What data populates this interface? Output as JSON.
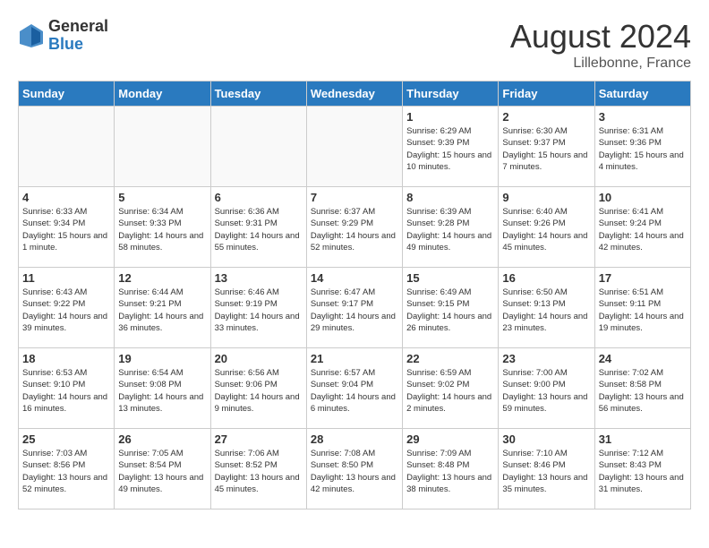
{
  "header": {
    "logo_general": "General",
    "logo_blue": "Blue",
    "month_year": "August 2024",
    "location": "Lillebonne, France"
  },
  "days_of_week": [
    "Sunday",
    "Monday",
    "Tuesday",
    "Wednesday",
    "Thursday",
    "Friday",
    "Saturday"
  ],
  "weeks": [
    [
      {
        "day": "",
        "info": ""
      },
      {
        "day": "",
        "info": ""
      },
      {
        "day": "",
        "info": ""
      },
      {
        "day": "",
        "info": ""
      },
      {
        "day": "1",
        "info": "Sunrise: 6:29 AM\nSunset: 9:39 PM\nDaylight: 15 hours\nand 10 minutes."
      },
      {
        "day": "2",
        "info": "Sunrise: 6:30 AM\nSunset: 9:37 PM\nDaylight: 15 hours\nand 7 minutes."
      },
      {
        "day": "3",
        "info": "Sunrise: 6:31 AM\nSunset: 9:36 PM\nDaylight: 15 hours\nand 4 minutes."
      }
    ],
    [
      {
        "day": "4",
        "info": "Sunrise: 6:33 AM\nSunset: 9:34 PM\nDaylight: 15 hours\nand 1 minute."
      },
      {
        "day": "5",
        "info": "Sunrise: 6:34 AM\nSunset: 9:33 PM\nDaylight: 14 hours\nand 58 minutes."
      },
      {
        "day": "6",
        "info": "Sunrise: 6:36 AM\nSunset: 9:31 PM\nDaylight: 14 hours\nand 55 minutes."
      },
      {
        "day": "7",
        "info": "Sunrise: 6:37 AM\nSunset: 9:29 PM\nDaylight: 14 hours\nand 52 minutes."
      },
      {
        "day": "8",
        "info": "Sunrise: 6:39 AM\nSunset: 9:28 PM\nDaylight: 14 hours\nand 49 minutes."
      },
      {
        "day": "9",
        "info": "Sunrise: 6:40 AM\nSunset: 9:26 PM\nDaylight: 14 hours\nand 45 minutes."
      },
      {
        "day": "10",
        "info": "Sunrise: 6:41 AM\nSunset: 9:24 PM\nDaylight: 14 hours\nand 42 minutes."
      }
    ],
    [
      {
        "day": "11",
        "info": "Sunrise: 6:43 AM\nSunset: 9:22 PM\nDaylight: 14 hours\nand 39 minutes."
      },
      {
        "day": "12",
        "info": "Sunrise: 6:44 AM\nSunset: 9:21 PM\nDaylight: 14 hours\nand 36 minutes."
      },
      {
        "day": "13",
        "info": "Sunrise: 6:46 AM\nSunset: 9:19 PM\nDaylight: 14 hours\nand 33 minutes."
      },
      {
        "day": "14",
        "info": "Sunrise: 6:47 AM\nSunset: 9:17 PM\nDaylight: 14 hours\nand 29 minutes."
      },
      {
        "day": "15",
        "info": "Sunrise: 6:49 AM\nSunset: 9:15 PM\nDaylight: 14 hours\nand 26 minutes."
      },
      {
        "day": "16",
        "info": "Sunrise: 6:50 AM\nSunset: 9:13 PM\nDaylight: 14 hours\nand 23 minutes."
      },
      {
        "day": "17",
        "info": "Sunrise: 6:51 AM\nSunset: 9:11 PM\nDaylight: 14 hours\nand 19 minutes."
      }
    ],
    [
      {
        "day": "18",
        "info": "Sunrise: 6:53 AM\nSunset: 9:10 PM\nDaylight: 14 hours\nand 16 minutes."
      },
      {
        "day": "19",
        "info": "Sunrise: 6:54 AM\nSunset: 9:08 PM\nDaylight: 14 hours\nand 13 minutes."
      },
      {
        "day": "20",
        "info": "Sunrise: 6:56 AM\nSunset: 9:06 PM\nDaylight: 14 hours\nand 9 minutes."
      },
      {
        "day": "21",
        "info": "Sunrise: 6:57 AM\nSunset: 9:04 PM\nDaylight: 14 hours\nand 6 minutes."
      },
      {
        "day": "22",
        "info": "Sunrise: 6:59 AM\nSunset: 9:02 PM\nDaylight: 14 hours\nand 2 minutes."
      },
      {
        "day": "23",
        "info": "Sunrise: 7:00 AM\nSunset: 9:00 PM\nDaylight: 13 hours\nand 59 minutes."
      },
      {
        "day": "24",
        "info": "Sunrise: 7:02 AM\nSunset: 8:58 PM\nDaylight: 13 hours\nand 56 minutes."
      }
    ],
    [
      {
        "day": "25",
        "info": "Sunrise: 7:03 AM\nSunset: 8:56 PM\nDaylight: 13 hours\nand 52 minutes."
      },
      {
        "day": "26",
        "info": "Sunrise: 7:05 AM\nSunset: 8:54 PM\nDaylight: 13 hours\nand 49 minutes."
      },
      {
        "day": "27",
        "info": "Sunrise: 7:06 AM\nSunset: 8:52 PM\nDaylight: 13 hours\nand 45 minutes."
      },
      {
        "day": "28",
        "info": "Sunrise: 7:08 AM\nSunset: 8:50 PM\nDaylight: 13 hours\nand 42 minutes."
      },
      {
        "day": "29",
        "info": "Sunrise: 7:09 AM\nSunset: 8:48 PM\nDaylight: 13 hours\nand 38 minutes."
      },
      {
        "day": "30",
        "info": "Sunrise: 7:10 AM\nSunset: 8:46 PM\nDaylight: 13 hours\nand 35 minutes."
      },
      {
        "day": "31",
        "info": "Sunrise: 7:12 AM\nSunset: 8:43 PM\nDaylight: 13 hours\nand 31 minutes."
      }
    ]
  ]
}
